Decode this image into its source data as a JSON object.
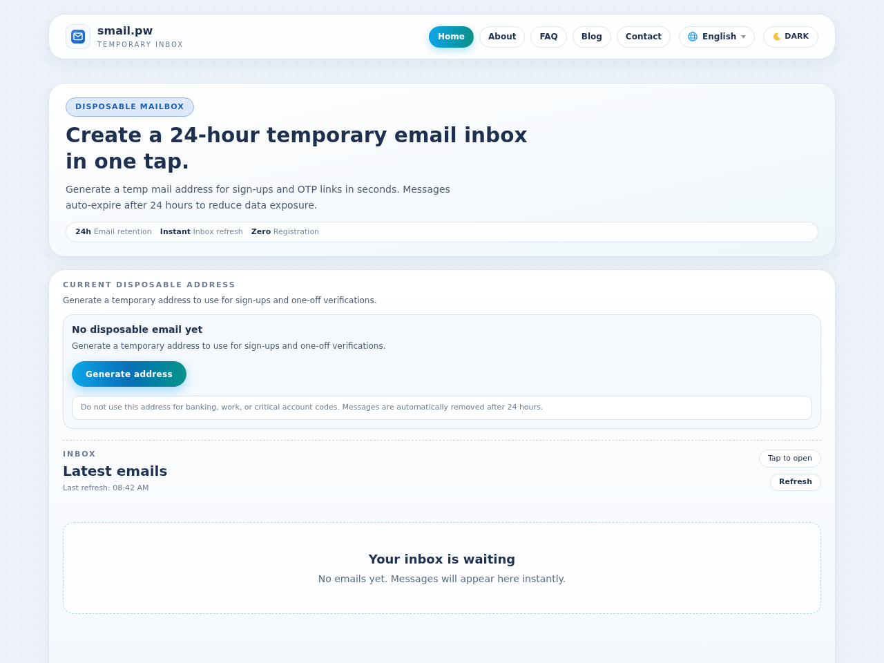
{
  "header": {
    "brand": {
      "title": "smail.pw",
      "subtitle": "TEMPORARY INBOX"
    },
    "nav": [
      {
        "label": "Home",
        "selected": true
      },
      {
        "label": "About",
        "selected": false
      },
      {
        "label": "FAQ",
        "selected": false
      },
      {
        "label": "Blog",
        "selected": false
      },
      {
        "label": "Contact",
        "selected": false
      }
    ],
    "language": {
      "label": "English"
    },
    "theme_toggle": {
      "label": "DARK"
    }
  },
  "hero": {
    "badge": "DISPOSABLE MAILBOX",
    "title": "Create a 24-hour temporary email inbox in one tap.",
    "description": "Generate a temp mail address for sign-ups and OTP links in seconds. Messages auto-expire after 24 hours to reduce data exposure.",
    "stats": [
      "**24h** Email retention",
      "**Instant** Inbox refresh",
      "**Zero** Registration"
    ]
  },
  "address_section": {
    "eyebrow": "CURRENT DISPOSABLE ADDRESS",
    "description": "Generate a temporary address to use for sign-ups and one-off verifications.",
    "empty_state": {
      "title": "No disposable email yet",
      "description": "Generate a temporary address to use for sign-ups and one-off verifications.",
      "button": "Generate address",
      "notice": "Do not use this address for banking, work, or critical account codes. Messages are automatically removed after 24 hours."
    }
  },
  "inbox": {
    "eyebrow": "INBOX",
    "title": "Latest emails",
    "last_refresh": "Last refresh: 08:42 AM",
    "hint": "Tap to open",
    "refresh_button": "Refresh",
    "empty_state": {
      "title": "Your inbox is waiting",
      "description": "No emails yet. Messages will appear here instantly."
    }
  }
}
